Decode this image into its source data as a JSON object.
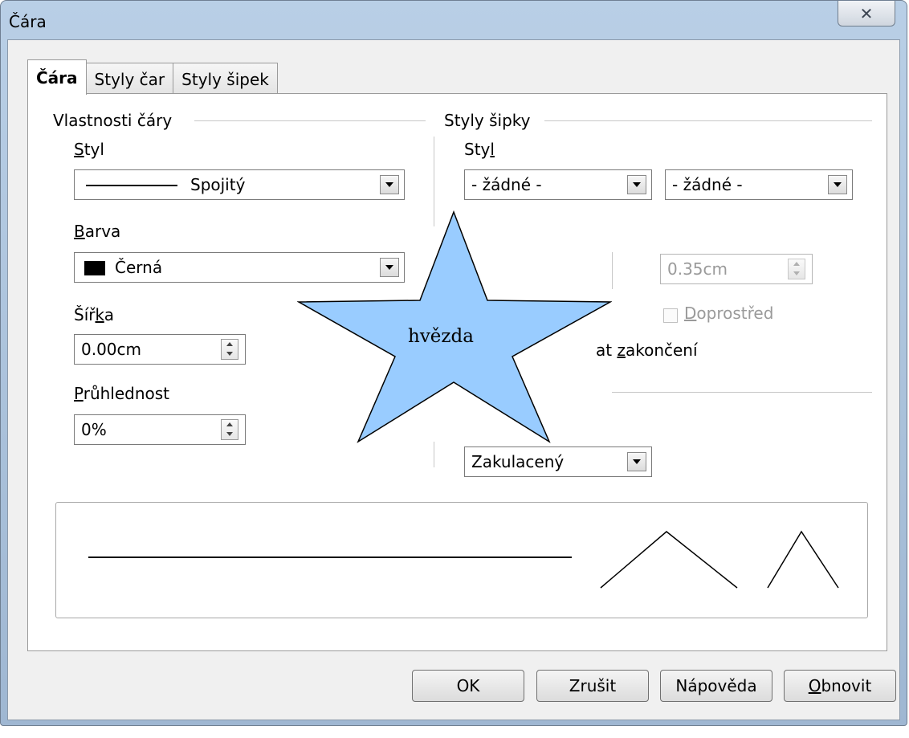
{
  "window": {
    "title": "Čára",
    "close_glyph": "✕"
  },
  "tabs": [
    {
      "label": "Čára",
      "active": true
    },
    {
      "label": "Styly čar",
      "active": false
    },
    {
      "label": "Styly šipek",
      "active": false
    }
  ],
  "line_properties": {
    "section_title": "Vlastnosti čáry",
    "style": {
      "label_prefix": "",
      "label_accel": "S",
      "label_rest": "tyl",
      "value": "Spojitý"
    },
    "color": {
      "label_prefix": "",
      "label_accel": "B",
      "label_rest": "arva",
      "value": "Černá",
      "swatch_color": "#000000"
    },
    "width": {
      "label_prefix": "Šíř",
      "label_accel": "k",
      "label_rest": "a",
      "value": "0.00cm"
    },
    "transparency": {
      "label_prefix": "",
      "label_accel": "P",
      "label_rest": "růhlednost",
      "value": "0%"
    }
  },
  "arrow_styles": {
    "section_title": "Styly šipky",
    "style": {
      "label_prefix": "Sty",
      "label_accel": "l",
      "label_rest": "",
      "start_value": "- žádné -",
      "end_value": "- žádné -"
    },
    "width_value": "0.35cm",
    "center": {
      "label_prefix": "",
      "label_accel": "D",
      "label_rest": "oprostřed",
      "checked": false
    },
    "sync_partial": {
      "prefix": "at ",
      "accel": "z",
      "rest": "akončení"
    }
  },
  "cap_style": {
    "value": "Zakulacený"
  },
  "overlay_shape": {
    "label": "hvězda",
    "fill": "#99ccff"
  },
  "buttons": {
    "ok": "OK",
    "cancel": "Zrušit",
    "help": "Nápověda",
    "reset": {
      "prefix": "",
      "accel": "O",
      "rest": "bnovit"
    }
  }
}
